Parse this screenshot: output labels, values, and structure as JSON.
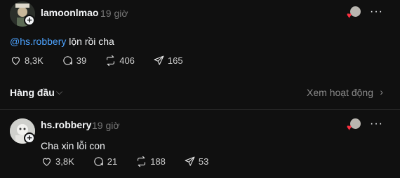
{
  "post": {
    "username": "lamoonlmao",
    "time": "19 giờ",
    "mention": "@hs.robbery",
    "text": " lộn rồi cha",
    "likes": "8,3K",
    "comments": "39",
    "reposts": "406",
    "shares": "165"
  },
  "sort": {
    "label": "Hàng đầu",
    "activity_link": "Xem hoạt động"
  },
  "reply": {
    "username": "hs.robbery",
    "time": "19 giờ",
    "text": "Cha xin lỗi con",
    "likes": "3,8K",
    "comments": "21",
    "reposts": "188",
    "shares": "53"
  },
  "colors": {
    "background": "#101010",
    "mention": "#4da3ff",
    "heart": "#ff3040",
    "muted": "#777777"
  },
  "icons": [
    "plus-icon",
    "heart-icon",
    "comment-icon",
    "repost-icon",
    "share-icon",
    "more-icon",
    "chevron-down-icon",
    "chevron-right-icon"
  ]
}
